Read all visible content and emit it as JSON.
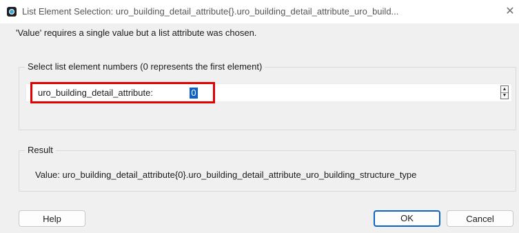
{
  "window": {
    "title": "List Element Selection: uro_building_detail_attribute{}.uro_building_detail_attribute_uro_build...",
    "close_glyph": "✕"
  },
  "message": "'Value' requires a single value but a list attribute was chosen.",
  "select_group": {
    "label": "Select list element numbers (0 represents the first element)",
    "field_label": "uro_building_detail_attribute:",
    "field_value": "0"
  },
  "result_group": {
    "label": "Result",
    "value_text": "Value:  uro_building_detail_attribute{0}.uro_building_detail_attribute_uro_building_structure_type"
  },
  "buttons": {
    "help": "Help",
    "ok": "OK",
    "cancel": "Cancel"
  },
  "colors": {
    "highlight_border": "#e00000",
    "selection": "#0b63c7"
  },
  "icons": {
    "app": "app-icon",
    "close": "close-icon",
    "spin_up": "spin-up-icon",
    "spin_down": "spin-down-icon"
  }
}
